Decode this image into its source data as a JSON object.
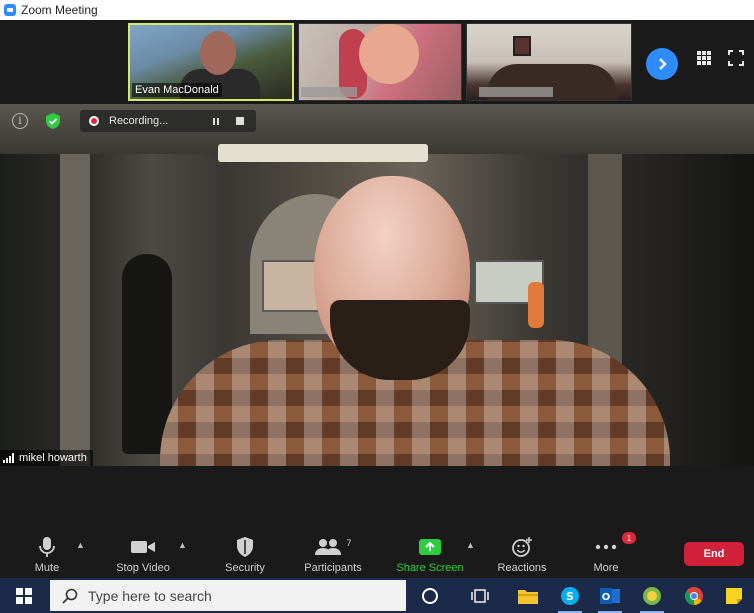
{
  "window": {
    "title": "Zoom Meeting"
  },
  "gallery": {
    "participants": [
      {
        "name": "Evan MacDonald"
      },
      {
        "name": ""
      },
      {
        "name": ""
      }
    ]
  },
  "recording": {
    "label": "Recording..."
  },
  "speaker": {
    "name": "mikel howarth"
  },
  "toolbar": {
    "mute_label": "Mute",
    "stop_video_label": "Stop Video",
    "security_label": "Security",
    "participants_label": "Participants",
    "participants_count": "7",
    "share_screen_label": "Share Screen",
    "reactions_label": "Reactions",
    "more_label": "More",
    "more_badge": "1",
    "end_label": "End"
  },
  "taskbar": {
    "search_placeholder": "Type here to search"
  },
  "colors": {
    "accent": "#2d8cff",
    "share_green": "#2ecc40",
    "end_red": "#d0203a",
    "record_red": "#e0283a"
  }
}
